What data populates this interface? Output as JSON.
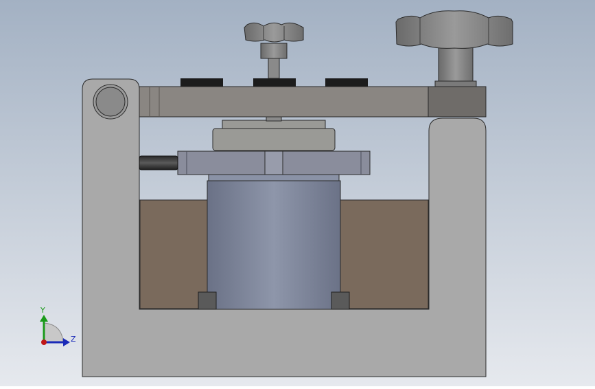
{
  "viewport": {
    "background_top": "#a3b1c3",
    "background_bottom": "#e6e9ee"
  },
  "triad": {
    "y_label": "Y",
    "z_label": "Z",
    "y_color": "#1a9a1a",
    "z_color": "#1a2ab8",
    "x_color": "#c01616"
  },
  "icons": {
    "view_triad": "triad-icon",
    "knob": "star-knob-icon"
  },
  "colors": {
    "frame": "#a9a9a9",
    "clamp_bar": "#8a8682",
    "cavity": "#7a6a5c",
    "cylinder": "#868ea3",
    "flange": "#8a8d9c",
    "disk": "#9a9a96",
    "knob": "#7d7d7d"
  }
}
